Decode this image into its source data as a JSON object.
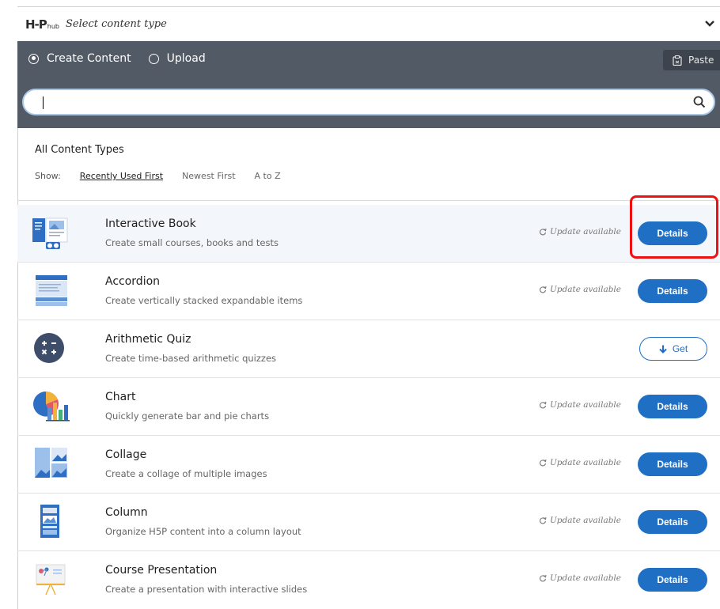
{
  "header": {
    "logo_big": "H-P",
    "logo_small": "hub",
    "title": "Select content type",
    "chevron_icon": "chevron-down-icon"
  },
  "tabs": [
    {
      "label": "Create Content",
      "selected": true
    },
    {
      "label": "Upload",
      "selected": false
    }
  ],
  "paste": {
    "label": "Paste",
    "icon": "clipboard-icon"
  },
  "search": {
    "value": "",
    "placeholder": "",
    "icon": "search-icon"
  },
  "filter": {
    "title": "All Content Types",
    "show_label": "Show:",
    "options": [
      "Recently Used First",
      "Newest First",
      "A to Z"
    ],
    "active": "Recently Used First"
  },
  "update_text": "Update available",
  "details_label": "Details",
  "get_label": "Get",
  "items": [
    {
      "title": "Interactive Book",
      "desc": "Create small courses, books and tests",
      "status": "update",
      "action": "Details",
      "icon": "interactive-book-icon"
    },
    {
      "title": "Accordion",
      "desc": "Create vertically stacked expandable items",
      "status": "update",
      "action": "Details",
      "icon": "accordion-icon"
    },
    {
      "title": "Arithmetic Quiz",
      "desc": "Create time-based arithmetic quizzes",
      "status": "",
      "action": "Get",
      "icon": "arithmetic-quiz-icon"
    },
    {
      "title": "Chart",
      "desc": "Quickly generate bar and pie charts",
      "status": "update",
      "action": "Details",
      "icon": "chart-icon"
    },
    {
      "title": "Collage",
      "desc": "Create a collage of multiple images",
      "status": "update",
      "action": "Details",
      "icon": "collage-icon"
    },
    {
      "title": "Column",
      "desc": "Organize H5P content into a column layout",
      "status": "update",
      "action": "Details",
      "icon": "column-icon"
    },
    {
      "title": "Course Presentation",
      "desc": "Create a presentation with interactive slides",
      "status": "update",
      "action": "Details",
      "icon": "course-presentation-icon"
    }
  ],
  "colors": {
    "accent": "#1f6fc5",
    "tabbar": "#525a65",
    "highlight_ring": "#ee1111"
  }
}
